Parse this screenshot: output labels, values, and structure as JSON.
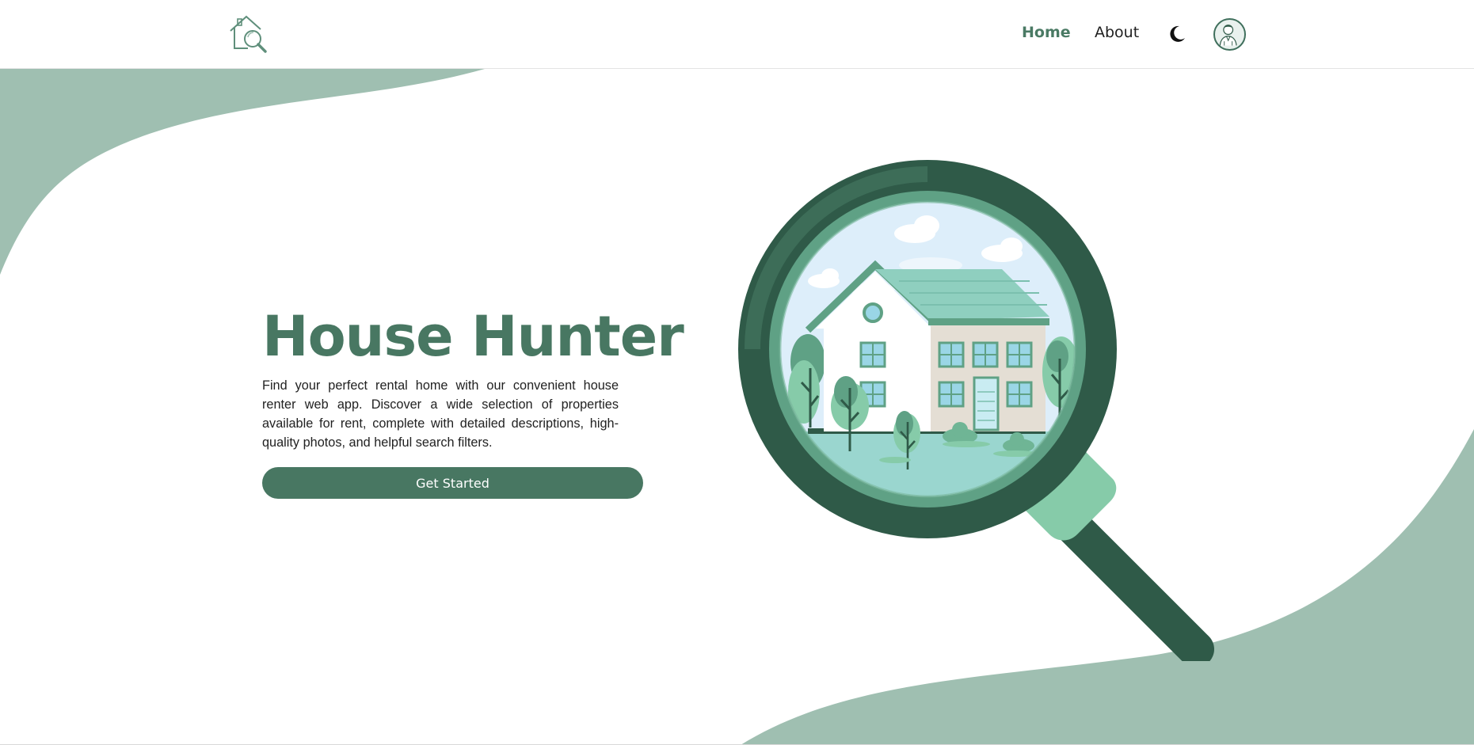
{
  "nav": {
    "logo_icon": "house-search-icon",
    "links": [
      {
        "label": "Home",
        "active": true
      },
      {
        "label": "About",
        "active": false
      }
    ],
    "theme_icon": "moon-icon",
    "avatar_icon": "user-avatar-icon"
  },
  "hero": {
    "title": "House Hunter",
    "description": "Find your perfect rental home with our convenient house renter web app. Discover a wide selection of properties available for rent, complete with detailed descriptions, high-quality photos, and helpful search filters.",
    "cta_label": "Get Started",
    "illustration_icon": "magnifier-house-illustration"
  },
  "colors": {
    "brand": "#487762",
    "wave": "#9fbfb1",
    "magnifier_dark": "#2f5a48",
    "magnifier_mid": "#5fa185",
    "handle_light": "#86cba9",
    "sky": "#ddeefa",
    "roof": "#8fcfbf"
  }
}
